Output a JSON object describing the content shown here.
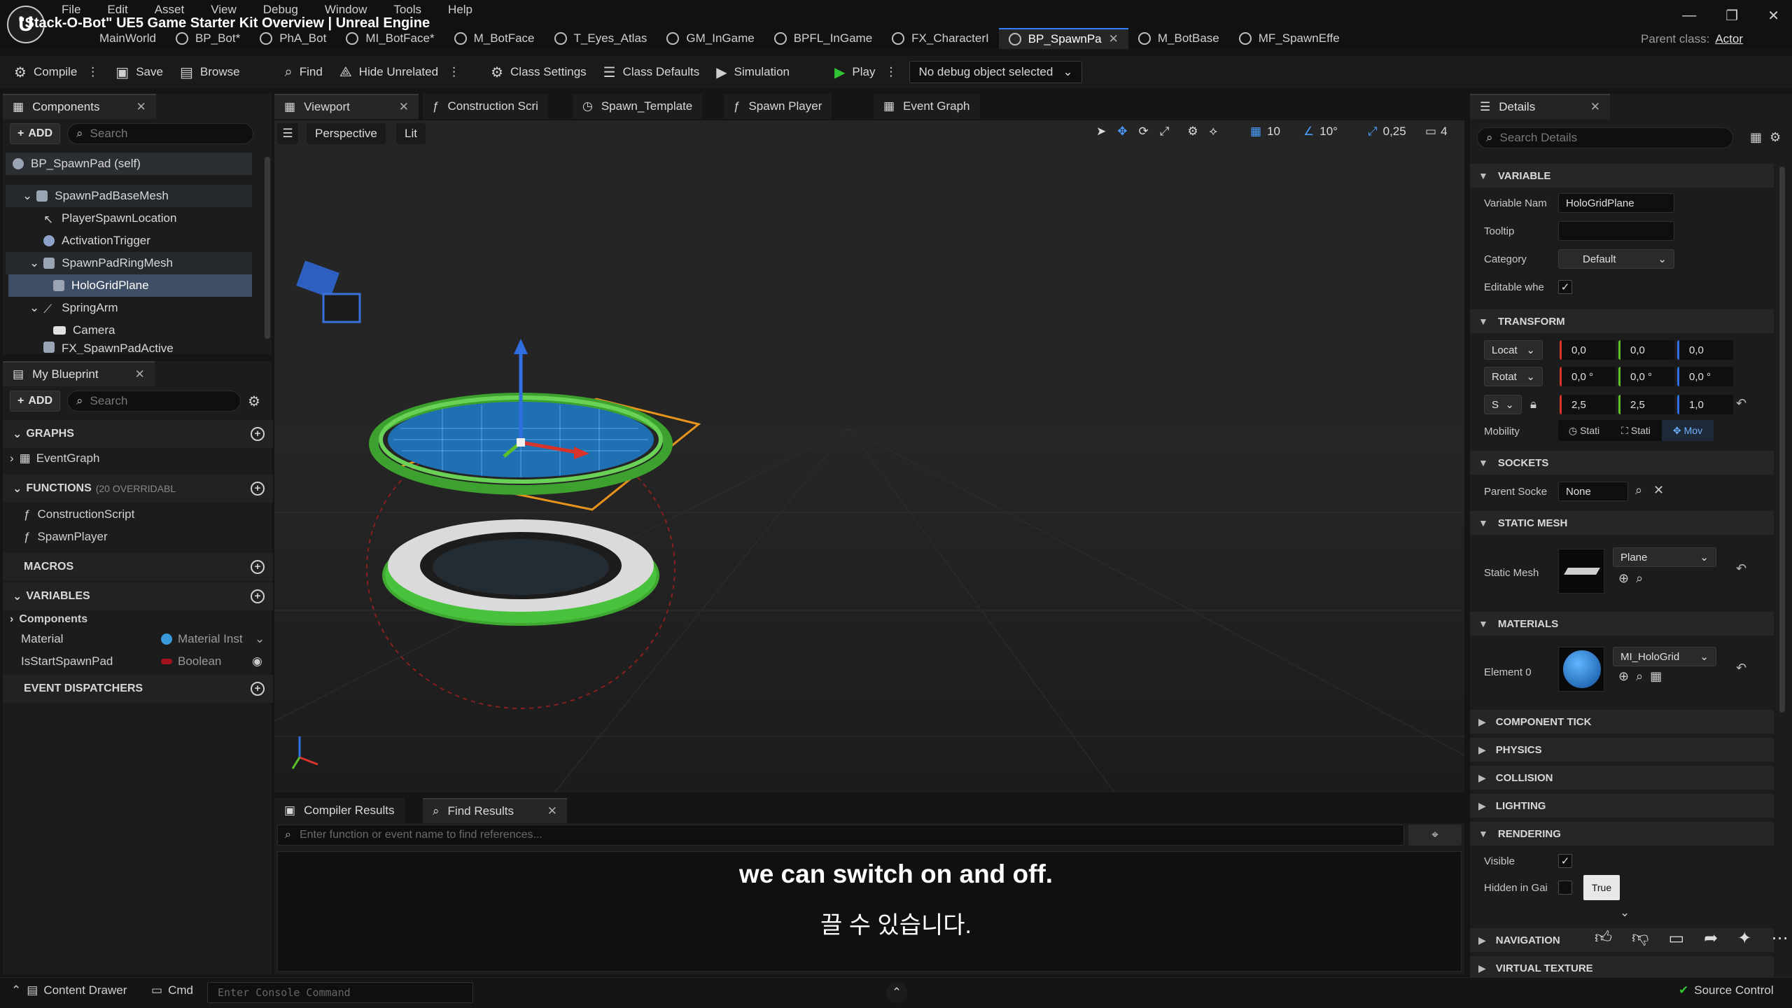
{
  "app": {
    "title": "\"Stack-O-Bot\" UE5 Game Starter Kit Overview | Unreal Engine"
  },
  "menu": [
    "File",
    "Edit",
    "Asset",
    "View",
    "Debug",
    "Window",
    "Tools",
    "Help"
  ],
  "doc_tabs": [
    {
      "label": "MainWorld"
    },
    {
      "label": "BP_Bot*"
    },
    {
      "label": "PhA_Bot"
    },
    {
      "label": "MI_BotFace*"
    },
    {
      "label": "M_BotFace"
    },
    {
      "label": "T_Eyes_Atlas"
    },
    {
      "label": "GM_InGame"
    },
    {
      "label": "BPFL_InGame"
    },
    {
      "label": "FX_CharacterI"
    },
    {
      "label": "BP_SpawnPa"
    },
    {
      "label": "M_BotBase"
    },
    {
      "label": "MF_SpawnEffe"
    }
  ],
  "parent_class": {
    "label": "Parent class:",
    "value": "Actor"
  },
  "toolbar": {
    "compile": "Compile",
    "save": "Save",
    "browse": "Browse",
    "find": "Find",
    "hide_unrelated": "Hide Unrelated",
    "class_settings": "Class Settings",
    "class_defaults": "Class Defaults",
    "simulation": "Simulation",
    "play": "Play",
    "debug_object": "No debug object selected"
  },
  "components": {
    "tab": "Components",
    "add": "ADD",
    "search_placeholder": "Search",
    "root": "BP_SpawnPad (self)",
    "items": [
      "SpawnPadBaseMesh",
      "PlayerSpawnLocation",
      "ActivationTrigger",
      "SpawnPadRingMesh",
      "HoloGridPlane",
      "SpringArm",
      "Camera",
      "FX_SpawnPadActive"
    ]
  },
  "my_blueprint": {
    "tab": "My Blueprint",
    "add": "ADD",
    "search_placeholder": "Search",
    "graphs": "GRAPHS",
    "event_graph": "EventGraph",
    "functions": "FUNCTIONS",
    "functions_note": "(20 OVERRIDABL",
    "function_items": [
      "ConstructionScript",
      "SpawnPlayer"
    ],
    "macros": "MACROS",
    "variables": "VARIABLES",
    "components_cat": "Components",
    "vars": [
      {
        "name": "Material",
        "type": "Material Inst"
      },
      {
        "name": "IsStartSpawnPad",
        "type": "Boolean"
      }
    ],
    "event_dispatchers": "EVENT DISPATCHERS"
  },
  "viewport_tabs": [
    "Viewport",
    "Construction Scri",
    "Spawn_Template",
    "Spawn Player",
    "Event Graph"
  ],
  "viewport": {
    "perspective": "Perspective",
    "lit": "Lit",
    "grid": "10",
    "angle": "10°",
    "scale": "0,25",
    "camera_speed": "4"
  },
  "bottom": {
    "tabs": [
      "Compiler Results",
      "Find Results"
    ],
    "find_placeholder": "Enter function or event name to find references..."
  },
  "subtitles": {
    "en": "we can switch on and off.",
    "ko": "끌 수 있습니다."
  },
  "details": {
    "tab": "Details",
    "search_placeholder": "Search Details",
    "variable": {
      "header": "VARIABLE",
      "name_label": "Variable Nam",
      "name_value": "HoloGridPlane",
      "tooltip_label": "Tooltip",
      "tooltip_value": "",
      "category_label": "Category",
      "category_value": "Default",
      "editable_label": "Editable whe"
    },
    "transform": {
      "header": "TRANSFORM",
      "location_label": "Locat",
      "location": [
        "0,0",
        "0,0",
        "0,0"
      ],
      "rotation_label": "Rotat",
      "rotation": [
        "0,0 °",
        "0,0 °",
        "0,0 °"
      ],
      "scale_label": "S",
      "scale": [
        "2,5",
        "2,5",
        "1,0"
      ],
      "mobility_label": "Mobility",
      "mobility": [
        "Stati",
        "Stati",
        "Mov"
      ]
    },
    "sockets": {
      "header": "SOCKETS",
      "parent_label": "Parent Socke",
      "parent_value": "None"
    },
    "static_mesh": {
      "header": "STATIC MESH",
      "label": "Static Mesh",
      "value": "Plane"
    },
    "materials": {
      "header": "MATERIALS",
      "label": "Element 0",
      "value": "MI_HoloGrid"
    },
    "collapsed": [
      "COMPONENT TICK",
      "PHYSICS",
      "COLLISION",
      "LIGHTING"
    ],
    "rendering": {
      "header": "RENDERING",
      "visible_label": "Visible",
      "hidden_label": "Hidden in Gai",
      "tooltip": "True"
    },
    "more": [
      "NAVIGATION",
      "VIRTUAL TEXTURE"
    ]
  },
  "status": {
    "content_drawer": "Content Drawer",
    "cmd": "Cmd",
    "console_placeholder": "Enter Console Command",
    "source_control": "Source Control"
  },
  "colors": {
    "accent": "#2f7fff",
    "x_axis": "#d8342b",
    "y_axis": "#5bbf2a",
    "z_axis": "#2f6fe0",
    "play": "#33c433"
  }
}
